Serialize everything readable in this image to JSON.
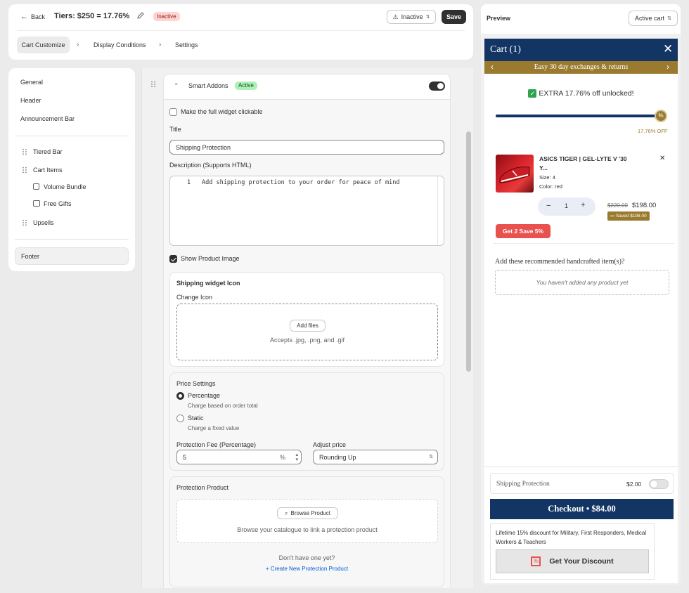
{
  "topbar": {
    "back_label": "Back",
    "title": "Tiers: $250 = 17.76%",
    "status_badge": "Inactive",
    "status_select": "Inactive",
    "save_label": "Save",
    "tabs": [
      "Cart Customize",
      "Display Conditions",
      "Settings"
    ]
  },
  "sidebar": {
    "items": [
      "General",
      "Header",
      "Announcement Bar"
    ],
    "sortable": [
      "Tiered Bar",
      "Cart Items",
      "Upsells"
    ],
    "sub_items": [
      "Volume Bundle",
      "Free Gifts"
    ],
    "footer": "Footer"
  },
  "editor": {
    "widget_name": "Smart Addons",
    "widget_badge": "Active",
    "clickable_label": "Make the full widget clickable",
    "title_label": "Title",
    "title_value": "Shipping Protection",
    "description_label": "Description (Supports HTML)",
    "code_line_number": "1",
    "code_line": "Add shipping protection to your order for peace of mind",
    "show_image_label": "Show Product Image",
    "icon_section_title": "Shipping widget Icon",
    "change_icon_label": "Change Icon",
    "add_files_label": "Add files",
    "accepts_label": "Accepts .jpg, .png, and .gif",
    "price_settings_label": "Price Settings",
    "percentage_label": "Percentage",
    "percentage_help": "Charge based on order total",
    "static_label": "Static",
    "static_help": "Charge a fixed value",
    "fee_label": "Protection Fee (Percentage)",
    "fee_value": "5",
    "fee_suffix": "%",
    "adjust_label": "Adjust price",
    "adjust_value": "Rounding Up",
    "protection_product_label": "Protection Product",
    "browse_label": "Browse Product",
    "browse_help": "Browse your catalogue to link a protection product",
    "no_product_label": "Don't have one yet?",
    "create_link": "+ Create New Protection Product"
  },
  "preview": {
    "heading": "Preview",
    "cart_state_select": "Active cart",
    "cart_title": "Cart (1)",
    "announcement": "Easy 30 day exchanges & returns",
    "unlock_message": "EXTRA 17.76% off unlocked!",
    "progress_label": "17.76% OFF",
    "progress_fraction": 1.0,
    "item_name": "ASICS TIGER | GEL-LYTE V '30 Y...",
    "item_size": "Size: 4",
    "item_color": "Color: red",
    "quantity": "1",
    "price_original": "$220.00",
    "price_current": "$198.00",
    "saved_badge": "Saved $198.00",
    "bundle_badge": "Get 2 Save 5%",
    "recommend_title": "Add these recommended handcrafted item(s)?",
    "recommend_empty": "You haven't added any product yet",
    "shipping_label": "Shipping Protection",
    "shipping_price": "$2.00",
    "checkout_label": "Checkout • $84.00",
    "discount_text": "Lifetime 15% discount for Military, First Responders, Medical Workers & Teachers",
    "discount_button": "Get Your Discount"
  },
  "colors": {
    "navy": "#123564",
    "gold": "#9a7a2e",
    "badge_red": "#fed3d1",
    "badge_green": "#aff0b5",
    "bundle_red": "#e8514e"
  }
}
